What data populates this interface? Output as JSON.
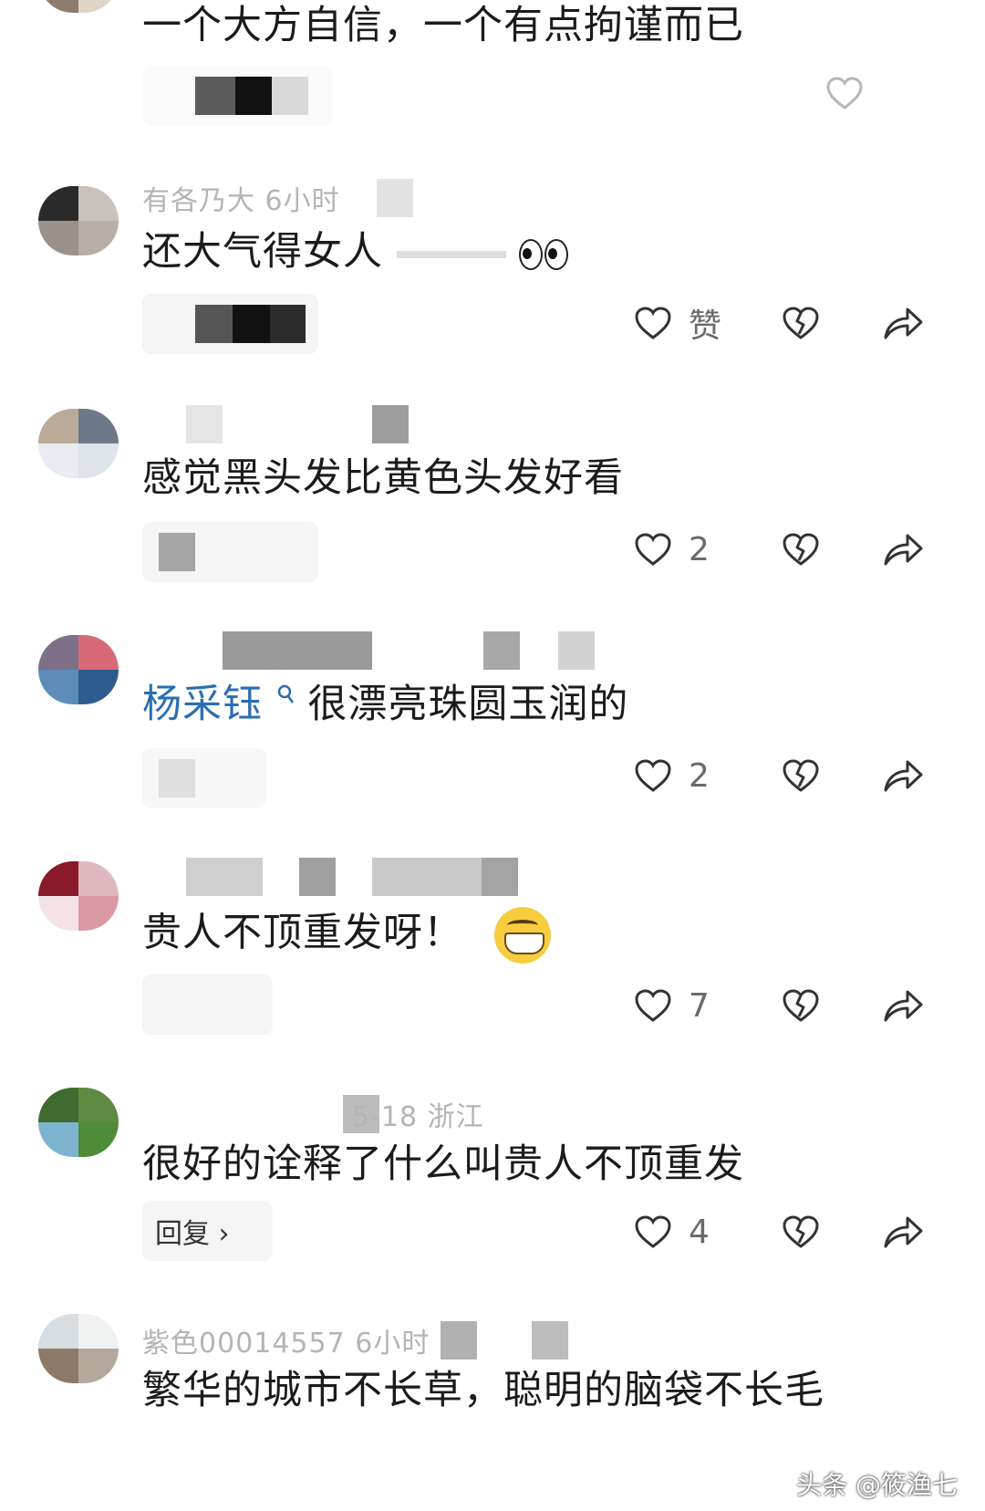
{
  "comments": [
    {
      "text": "一个大方自信，一个有点拘谨而已",
      "likes": ""
    },
    {
      "meta": "有各乃大 6小时",
      "text": "还大气得女人",
      "likes": "赞"
    },
    {
      "text": "感觉黑头发比黄色头发好看",
      "likes": "2"
    },
    {
      "mention": "杨采钰",
      "text": "很漂亮珠圆玉润的",
      "likes": "2"
    },
    {
      "text": "贵人不顶重发呀！",
      "likes": "7"
    },
    {
      "meta": "5-18 浙江",
      "text": "很好的诠释了什么叫贵人不顶重发",
      "reply_label": "回复 ›",
      "likes": "4"
    },
    {
      "meta": "紫色00014557 6小时",
      "text": "繁华的城市不长草，聪明的脑袋不长毛"
    }
  ],
  "watermark": "头条 @筱渔七",
  "icons": {
    "like": "heart-outline-icon",
    "dislike": "broken-heart-icon",
    "share": "share-arrow-icon",
    "search": "search-icon"
  },
  "colors": {
    "mention": "#2a6db3",
    "text": "#1b1b1b",
    "muted": "#b4b4b4",
    "icon": "#333333"
  }
}
